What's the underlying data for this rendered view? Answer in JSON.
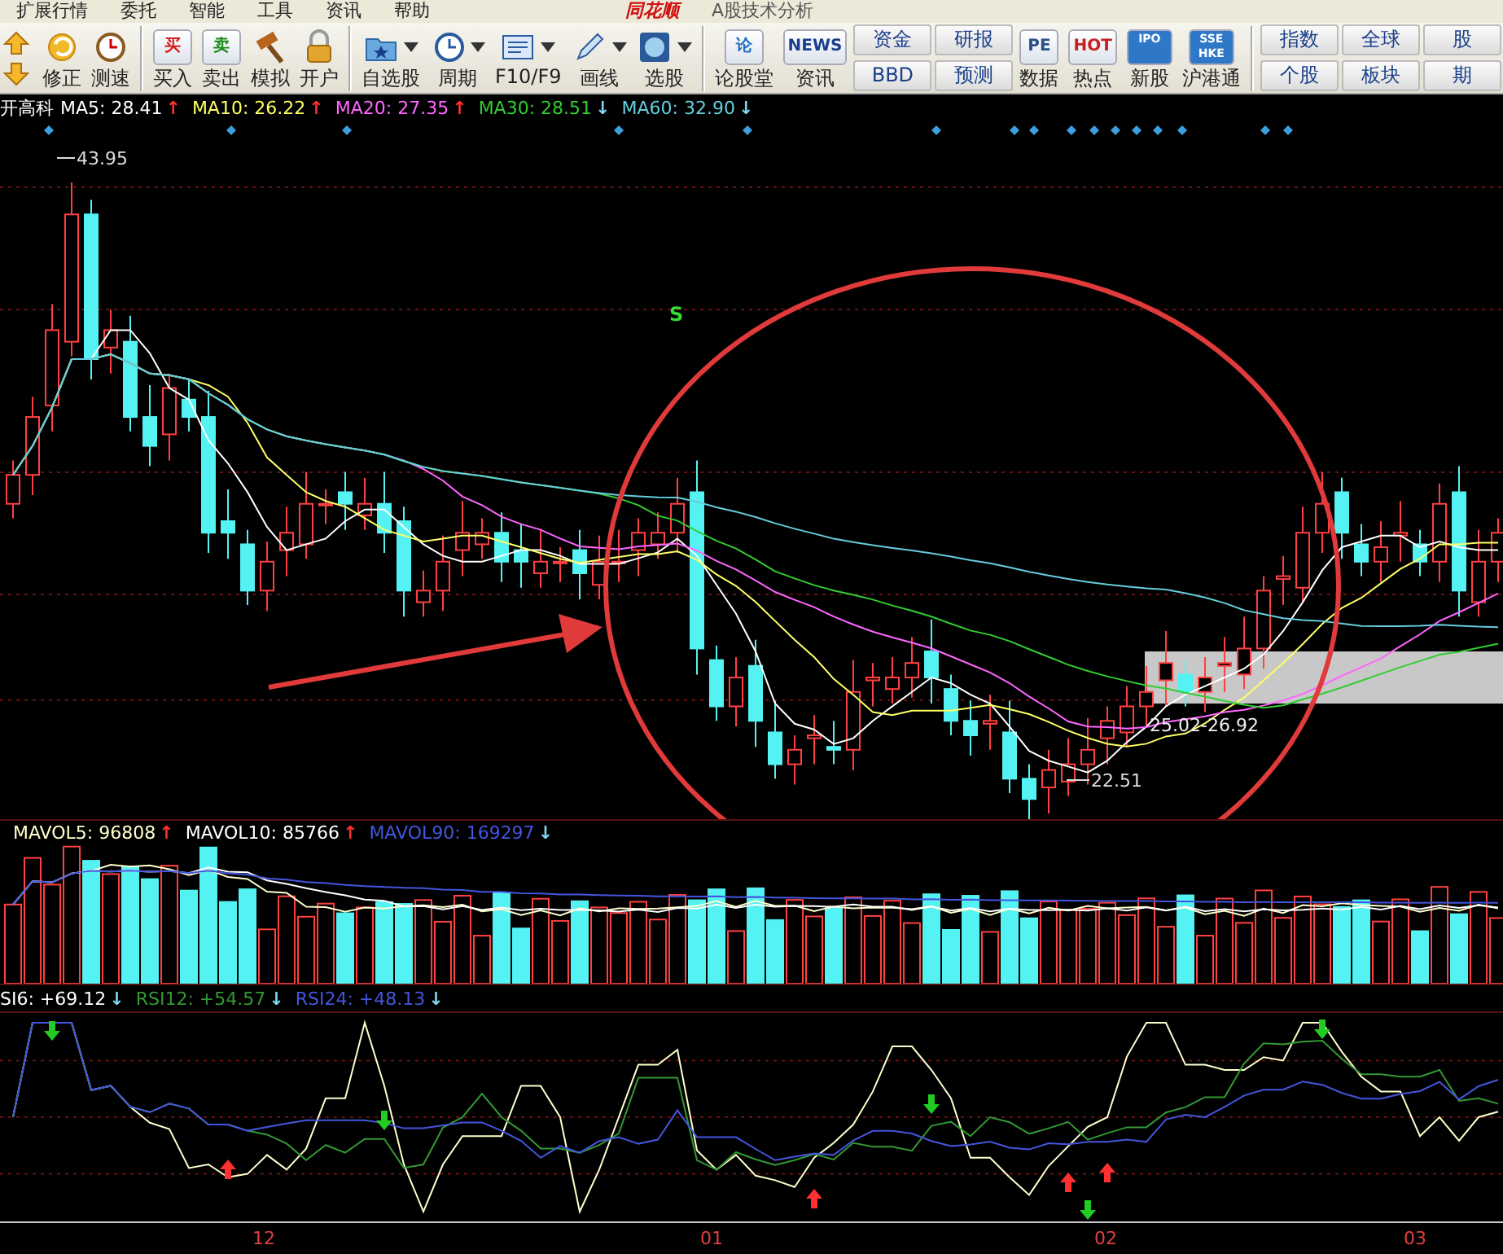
{
  "menu": {
    "items": [
      "扩展行情",
      "委托",
      "智能",
      "工具",
      "资讯",
      "帮助"
    ],
    "logo": "同花顺",
    "title": "A股技术分析"
  },
  "toolbar": [
    [
      {
        "kind": "button",
        "label": "修正"
      },
      {
        "kind": "button",
        "label": "测速"
      }
    ],
    [
      {
        "kind": "button",
        "label": "买入",
        "badge": "买",
        "color": "#d81e1e"
      },
      {
        "kind": "button",
        "label": "卖出",
        "badge": "卖",
        "color": "#1a8a1a"
      },
      {
        "kind": "button",
        "label": "模拟"
      },
      {
        "kind": "button",
        "label": "开户"
      }
    ],
    [
      {
        "kind": "dropdown",
        "label": "自选股"
      },
      {
        "kind": "dropdown",
        "label": "周期"
      },
      {
        "kind": "dropdown",
        "label": "F10/F9"
      },
      {
        "kind": "dropdown",
        "label": "画线"
      },
      {
        "kind": "dropdown",
        "label": "选股"
      }
    ],
    [
      {
        "kind": "button",
        "label": "论股堂",
        "badge": "论",
        "color": "#1f6fc0"
      },
      {
        "kind": "button",
        "label": "资讯",
        "badge": "NEWS",
        "color": "#1b3f8f"
      },
      {
        "kind": "stack",
        "labels": [
          "资金",
          "BBD"
        ]
      },
      {
        "kind": "stack",
        "labels": [
          "研报",
          "预测"
        ]
      },
      {
        "kind": "button",
        "label": "数据",
        "badge": "PE",
        "color": "#2a4f8a"
      },
      {
        "kind": "button",
        "label": "热点",
        "badge": "HOT",
        "color": "#c82020"
      },
      {
        "kind": "button",
        "label": "新股",
        "badge": "IPO"
      },
      {
        "kind": "button",
        "label": "沪港通",
        "badge": "SSE HKE"
      }
    ],
    [
      {
        "kind": "stack",
        "labels": [
          "指数",
          "个股"
        ]
      },
      {
        "kind": "stack",
        "labels": [
          "全球",
          "板块"
        ]
      },
      {
        "kind": "stack",
        "labels": [
          "股",
          "期"
        ]
      }
    ]
  ],
  "price_legend": {
    "stock": "开高科",
    "items": [
      {
        "text": "MA5: 28.41",
        "color": "#ffffff",
        "arrow": {
          "text": "↑",
          "color": "#ff3030"
        }
      },
      {
        "text": "MA10: 26.22",
        "color": "#ffff66",
        "arrow": {
          "text": "↑",
          "color": "#ff3030"
        }
      },
      {
        "text": "MA20: 27.35",
        "color": "#ff66ff",
        "arrow": {
          "text": "↑",
          "color": "#ff3030"
        }
      },
      {
        "text": "MA30: 28.51",
        "color": "#33cc33",
        "arrow": {
          "text": "↓",
          "color": "#7fd8f0"
        }
      },
      {
        "text": "MA60: 32.90",
        "color": "#66ccdd",
        "arrow": {
          "text": "↓",
          "color": "#7fd8f0"
        }
      }
    ]
  },
  "price_chart": {
    "high_label": "43.95",
    "low_label": "22.51",
    "range_label": "25.02-26.92",
    "signal": "S"
  },
  "volume_legend": [
    {
      "text": "MAVOL5: 96808",
      "color": "#ffffcc",
      "arrow": {
        "text": "↑",
        "color": "#ff3030"
      }
    },
    {
      "text": "MAVOL10: 85766",
      "color": "#ffffff",
      "arrow": {
        "text": "↑",
        "color": "#ff3030"
      }
    },
    {
      "text": "MAVOL90: 169297",
      "color": "#4455dd",
      "arrow": {
        "text": "↓",
        "color": "#7fd8f0"
      }
    }
  ],
  "rsi_legend": [
    {
      "text": "SI6: +69.12",
      "color": "#ffffff",
      "arrow": {
        "text": "↓",
        "color": "#7fd8f0"
      }
    },
    {
      "text": "RSI12: +54.57",
      "color": "#339933",
      "arrow": {
        "text": "↓",
        "color": "#7fd8f0"
      }
    },
    {
      "text": "RSI24: +48.13",
      "color": "#4455dd",
      "arrow": {
        "text": "↓",
        "color": "#7fd8f0"
      }
    }
  ],
  "time_axis": [
    "12",
    "01",
    "02",
    "03"
  ]
}
